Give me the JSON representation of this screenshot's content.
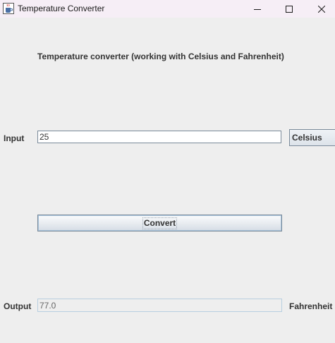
{
  "window": {
    "title": "Temperature Converter",
    "icon": "java-coffee-cup-icon",
    "controls": [
      "minimize-icon",
      "maximize-icon",
      "close-icon"
    ]
  },
  "form": {
    "heading": "Temperature converter (working with Celsius and Fahrenheit)",
    "input_label": "Input",
    "input_value": "25",
    "input_unit": "Celsius",
    "convert_label": "Convert",
    "output_label": "Output",
    "output_value": "77.0",
    "output_unit": "Fahrenheit"
  },
  "colors": {
    "title_bar": "#f6eef6",
    "content_background": "#eeeeee",
    "control_border": "#7a8a99",
    "button_focus_border": "#a9c4dc"
  }
}
